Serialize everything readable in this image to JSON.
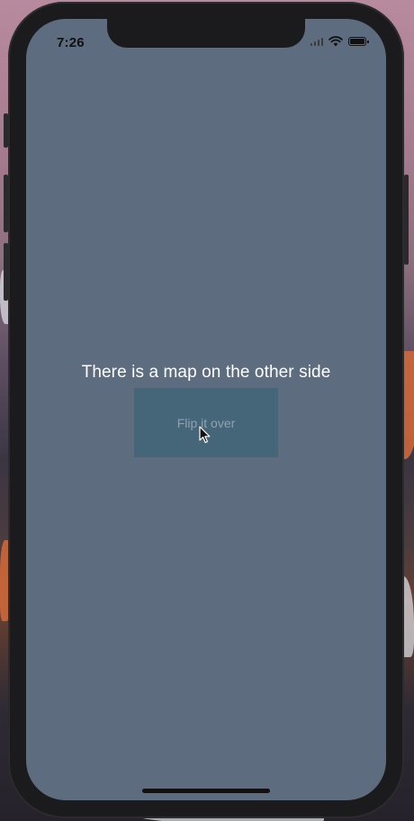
{
  "status_bar": {
    "time": "7:26",
    "icons": [
      "signal-icon",
      "wifi-icon",
      "battery-icon"
    ]
  },
  "main": {
    "message": "There is a map on the other side",
    "flip_button_label": "Flip it over"
  },
  "colors": {
    "screen_background": "#5d6c7f",
    "button_background": "#456579",
    "button_text": "#8ea3b2",
    "message_text": "#ffffff"
  }
}
